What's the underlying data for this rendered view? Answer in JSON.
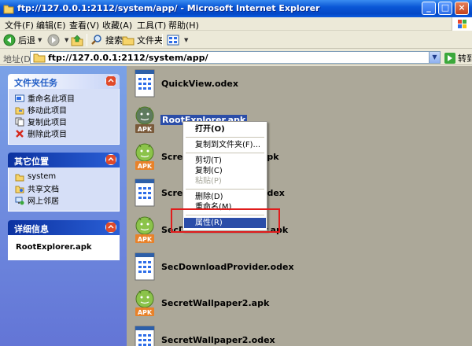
{
  "window": {
    "title": "ftp://127.0.0.1:2112/system/app/ - Microsoft Internet Explorer",
    "controls": {
      "minimize": "_",
      "maximize": "□",
      "close": "×"
    }
  },
  "menubar": [
    "文件(F)",
    "编辑(E)",
    "查看(V)",
    "收藏(A)",
    "工具(T)",
    "帮助(H)"
  ],
  "toolbar": {
    "back": "后退",
    "search": "搜索",
    "folders": "文件夹"
  },
  "address": {
    "label": "地址(D)",
    "url": "ftp://127.0.0.1:2112/system/app/",
    "go": "转到"
  },
  "sidebar": {
    "tasks": {
      "title": "文件夹任务",
      "items": [
        "重命名此项目",
        "移动此项目",
        "复制此项目",
        "删除此项目"
      ]
    },
    "places": {
      "title": "其它位置",
      "items": [
        "system",
        "共享文档",
        "网上邻居"
      ]
    },
    "details": {
      "title": "详细信息",
      "value": "RootExplorer.apk"
    }
  },
  "files": [
    {
      "name": "QuickView.odex",
      "type": "odex"
    },
    {
      "name": "RootExplorer.apk",
      "type": "apk",
      "selected": true
    },
    {
      "name": "ScreenCaptureShell.apk",
      "type": "apk"
    },
    {
      "name": "ScreenCaptureShell.odex",
      "type": "odex"
    },
    {
      "name": "SecDownloadProvider.apk",
      "type": "apk"
    },
    {
      "name": "SecDownloadProvider.odex",
      "type": "odex"
    },
    {
      "name": "SecretWallpaper2.apk",
      "type": "apk"
    },
    {
      "name": "SecretWallpaper2.odex",
      "type": "odex"
    }
  ],
  "apk_badge": "APK",
  "context_menu": {
    "open": "打开(O)",
    "copy_to_folder": "复制到文件夹(F)...",
    "cut": "剪切(T)",
    "copy": "复制(C)",
    "paste": "粘贴(P)",
    "delete": "删除(D)",
    "rename": "重命名(M)",
    "properties": "属性(R)"
  },
  "colors": {
    "highlight": "#2B4DA8",
    "annotation": "#E01C1C",
    "title_bar": "#0A57D6"
  }
}
